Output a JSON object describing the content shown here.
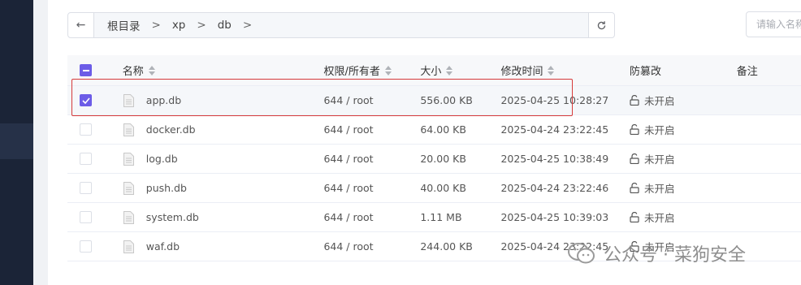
{
  "toolbar": {
    "breadcrumbs": [
      "根目录",
      "xp",
      "db"
    ],
    "separator": ">",
    "search_placeholder": "请输入名称"
  },
  "table": {
    "columns": {
      "name": "名称",
      "perm": "权限/所有者",
      "size": "大小",
      "mtime": "修改时间",
      "protect": "防篡改",
      "note": "备注"
    },
    "rows": [
      {
        "name": "app.db",
        "perm": "644 / root",
        "size": "556.00 KB",
        "mtime": "2025-04-25 10:28:27",
        "protect": "未开启",
        "selected": true
      },
      {
        "name": "docker.db",
        "perm": "644 / root",
        "size": "64.00 KB",
        "mtime": "2025-04-24 23:22:45",
        "protect": "未开启",
        "selected": false
      },
      {
        "name": "log.db",
        "perm": "644 / root",
        "size": "20.00 KB",
        "mtime": "2025-04-25 10:38:49",
        "protect": "未开启",
        "selected": false
      },
      {
        "name": "push.db",
        "perm": "644 / root",
        "size": "40.00 KB",
        "mtime": "2025-04-24 23:22:46",
        "protect": "未开启",
        "selected": false
      },
      {
        "name": "system.db",
        "perm": "644 / root",
        "size": "1.11 MB",
        "mtime": "2025-04-25 10:39:03",
        "protect": "未开启",
        "selected": false
      },
      {
        "name": "waf.db",
        "perm": "644 / root",
        "size": "244.00 KB",
        "mtime": "2025-04-24 23:22:45",
        "protect": "未开启",
        "selected": false
      }
    ]
  },
  "watermark": {
    "text": "公众号 · 菜狗安全"
  },
  "colors": {
    "accent": "#6c5ce7",
    "highlight": "#d63a3a",
    "sidebar": "#1b2437"
  },
  "icons": [
    "back-arrow-icon",
    "refresh-icon",
    "file-icon",
    "unlock-icon",
    "wechat-icon"
  ]
}
